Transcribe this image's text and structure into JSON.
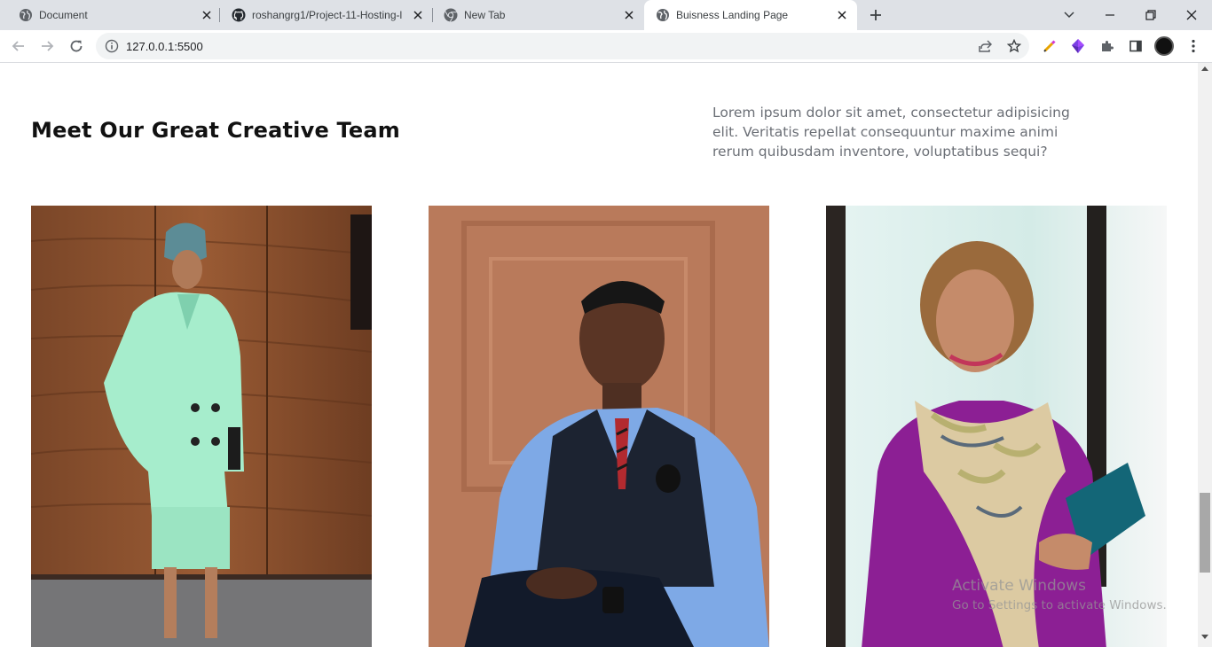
{
  "browser": {
    "tabs": [
      {
        "title": "Document",
        "icon": "globe-icon"
      },
      {
        "title": "roshangrg1/Project-11-Hosting-l",
        "icon": "github-icon"
      },
      {
        "title": "New Tab",
        "icon": "chrome-icon"
      },
      {
        "title": "Buisness Landing Page",
        "icon": "globe-icon",
        "active": true
      }
    ],
    "address": "127.0.0.1:5500"
  },
  "team_section": {
    "heading": "Meet Our Great Creative Team",
    "description": "Lorem ipsum dolor sit amet, consectetur adipisicing elit. Veritatis repellat consequuntur maxime animi rerum quibusdam inventore, voluptatibus sequi?",
    "members": [
      {
        "photo": "woman-in-mint-suit"
      },
      {
        "photo": "man-in-blue-shirt-and-vest"
      },
      {
        "photo": "woman-in-purple-dress-with-scarf"
      }
    ]
  },
  "os_watermark": {
    "line1": "Activate Windows",
    "line2": "Go to Settings to activate Windows."
  },
  "colors": {
    "tabstrip": "#dee1e6",
    "heading": "#111111",
    "body_text": "#6b6f76"
  }
}
